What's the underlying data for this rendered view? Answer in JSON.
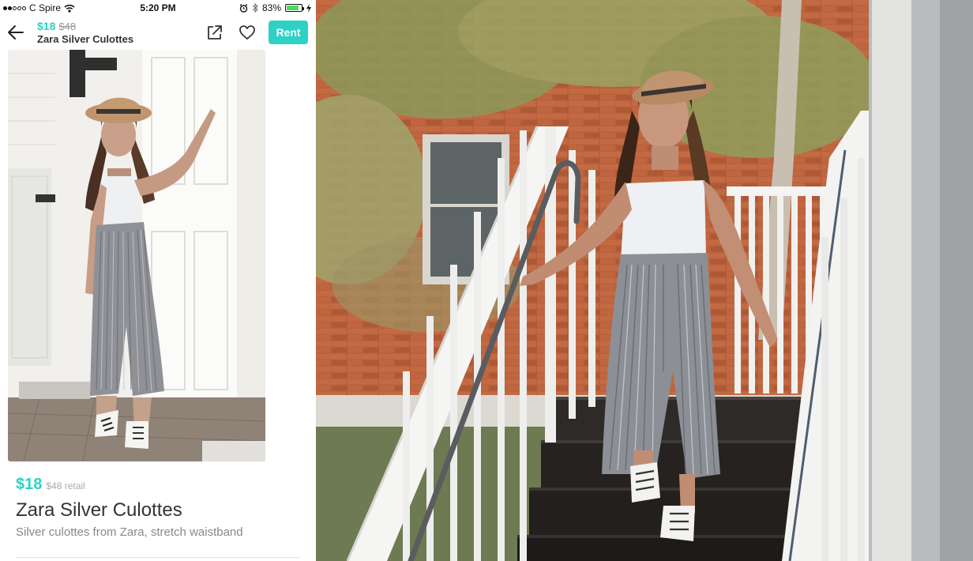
{
  "status_bar": {
    "carrier": "C Spire",
    "time": "5:20 PM",
    "battery": "83%",
    "battery_level": 0.83
  },
  "nav": {
    "price": "$18",
    "retail_price": "$48",
    "title": "Zara Silver Culottes",
    "rent_label": "Rent"
  },
  "product": {
    "price": "$18",
    "retail": "$48 retail",
    "title": "Zara Silver Culottes",
    "description": "Silver culottes from Zara, stretch waistband"
  },
  "colors": {
    "accent": "#2ed1c5",
    "text": "#333333",
    "muted": "#888888"
  },
  "icons": [
    "back-arrow-icon",
    "share-icon",
    "heart-icon",
    "wifi-icon",
    "alarm-icon",
    "bluetooth-icon",
    "battery-icon"
  ]
}
